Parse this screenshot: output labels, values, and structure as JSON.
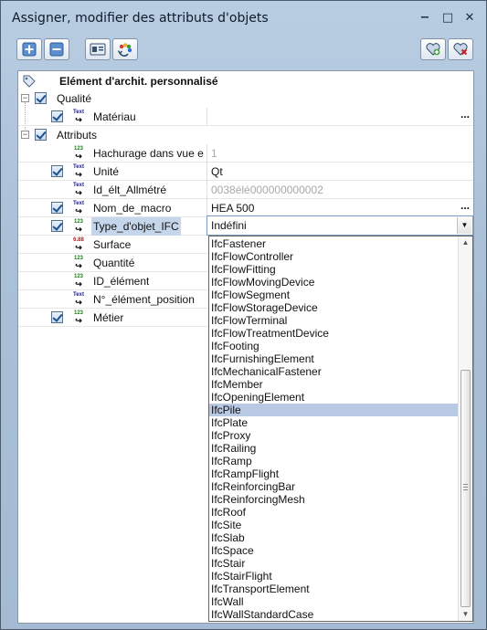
{
  "window": {
    "title": "Assigner, modifier des attributs d'objets",
    "controls": [
      "−",
      "□",
      "✕"
    ]
  },
  "toolbar": {
    "buttons": [
      {
        "name": "add-attribute-button",
        "icon": "plus-icon"
      },
      {
        "name": "remove-attribute-button",
        "icon": "minus-icon"
      },
      {
        "name": "id-card-button",
        "icon": "id-card-icon"
      },
      {
        "name": "color-refresh-button",
        "icon": "palette-refresh-icon"
      },
      {
        "name": "favorite-add-button",
        "icon": "heart-plus-icon"
      },
      {
        "name": "favorite-remove-button",
        "icon": "heart-remove-icon"
      }
    ]
  },
  "header": {
    "label": "Elément d'archit. personnalisé",
    "icon": "tag-icon"
  },
  "groups": [
    {
      "label": "Qualité",
      "expander": "−"
    },
    {
      "label": "Attributs",
      "expander": "−"
    }
  ],
  "rows": [
    {
      "label": "Matériau",
      "type": "Text",
      "value": "",
      "checked": true,
      "ellipsis": true
    },
    {
      "label": "Hachurage dans vue e",
      "type": "123",
      "value": "1",
      "checked": false,
      "muted": true
    },
    {
      "label": "Unité",
      "type": "Text",
      "value": "Qt",
      "checked": true
    },
    {
      "label": "Id_élt_Allmétré",
      "type": "Text",
      "value": "0038élé000000000002",
      "checked": false,
      "muted": true
    },
    {
      "label": "Nom_de_macro",
      "type": "Text",
      "value": "HEA 500",
      "checked": true,
      "ellipsis": true
    },
    {
      "label": "Type_d'objet_IFC",
      "type": "123",
      "value": "Indéfini",
      "checked": true,
      "highlight": true
    },
    {
      "label": "Surface",
      "type": "6.88",
      "value": "",
      "checked": false
    },
    {
      "label": "Quantité",
      "type": "123",
      "value": "",
      "checked": false
    },
    {
      "label": "ID_élément",
      "type": "123",
      "value": "",
      "checked": false
    },
    {
      "label": "N°_élément_position",
      "type": "Text",
      "value": "",
      "checked": false
    },
    {
      "label": "Métier",
      "type": "123",
      "value": "",
      "checked": true
    }
  ],
  "dropdown": {
    "selected": "Indéfini",
    "arrow": "▼",
    "options": [
      "IfcFastener",
      "IfcFlowController",
      "IfcFlowFitting",
      "IfcFlowMovingDevice",
      "IfcFlowSegment",
      "IfcFlowStorageDevice",
      "IfcFlowTerminal",
      "IfcFlowTreatmentDevice",
      "IfcFooting",
      "IfcFurnishingElement",
      "IfcMechanicalFastener",
      "IfcMember",
      "IfcOpeningElement",
      "IfcPile",
      "IfcPlate",
      "IfcProxy",
      "IfcRailing",
      "IfcRamp",
      "IfcRampFlight",
      "IfcReinforcingBar",
      "IfcReinforcingMesh",
      "IfcRoof",
      "IfcSite",
      "IfcSlab",
      "IfcSpace",
      "IfcStair",
      "IfcStairFlight",
      "IfcTransportElement",
      "IfcWall",
      "IfcWallStandardCase"
    ],
    "highlighted": "IfcPile"
  },
  "type_labels": {
    "Text": "Text",
    "123": "123",
    "6.88": "6.88"
  },
  "colors": {
    "type_text": "#1a1a9a",
    "type_num": "#1a7a1a",
    "type_float": "#b01a1a",
    "selection": "#b9c9e3"
  }
}
